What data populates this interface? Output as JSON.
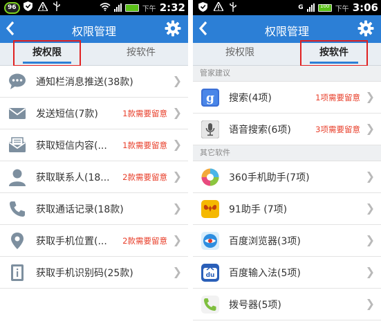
{
  "left": {
    "status": {
      "badge": "96",
      "xiawu": "下午",
      "time": "2:32"
    },
    "header": {
      "title": "权限管理"
    },
    "tabs": [
      {
        "label": "按权限"
      },
      {
        "label": "按软件"
      }
    ],
    "items": [
      {
        "icon": "chat-bubble-icon",
        "label": "通知栏消息推送(38款)",
        "warning": ""
      },
      {
        "icon": "envelope-icon",
        "label": "发送短信(7款)",
        "warning": "1款需要留意"
      },
      {
        "icon": "envelope-open-icon",
        "label": "获取短信内容(...",
        "warning": "1款需要留意"
      },
      {
        "icon": "person-icon",
        "label": "获取联系人(18...",
        "warning": "2款需要留意"
      },
      {
        "icon": "phone-icon",
        "label": "获取通话记录(18款)",
        "warning": ""
      },
      {
        "icon": "location-pin-icon",
        "label": "获取手机位置(...",
        "warning": "2款需要留意"
      },
      {
        "icon": "id-card-icon",
        "label": "获取手机识别码(25款)",
        "warning": ""
      }
    ]
  },
  "right": {
    "status": {
      "signal_letter": "G",
      "battery": "100",
      "xiawu": "下午",
      "time": "3:06"
    },
    "header": {
      "title": "权限管理"
    },
    "tabs": [
      {
        "label": "按权限"
      },
      {
        "label": "按软件"
      }
    ],
    "section_suggested": "管家建议",
    "suggested": [
      {
        "icon": "google-search-icon",
        "label": "搜索(4项)",
        "warning": "1项需要留意"
      },
      {
        "icon": "voice-search-icon",
        "label": "语音搜索(6项)",
        "warning": "3项需要留意"
      }
    ],
    "section_other": "其它软件",
    "others": [
      {
        "icon": "360-assistant-icon",
        "label": "360手机助手(7项)"
      },
      {
        "icon": "91-assistant-icon",
        "label": "91助手 (7项)"
      },
      {
        "icon": "baidu-browser-icon",
        "label": "百度浏览器(3项)"
      },
      {
        "icon": "baidu-input-icon",
        "label": "百度输入法(5项)"
      },
      {
        "icon": "dialer-icon",
        "label": "拨号器(5项)"
      }
    ]
  },
  "colors": {
    "accent": "#2c7fd6",
    "warning": "#e8402c",
    "highlight": "#e02020"
  }
}
